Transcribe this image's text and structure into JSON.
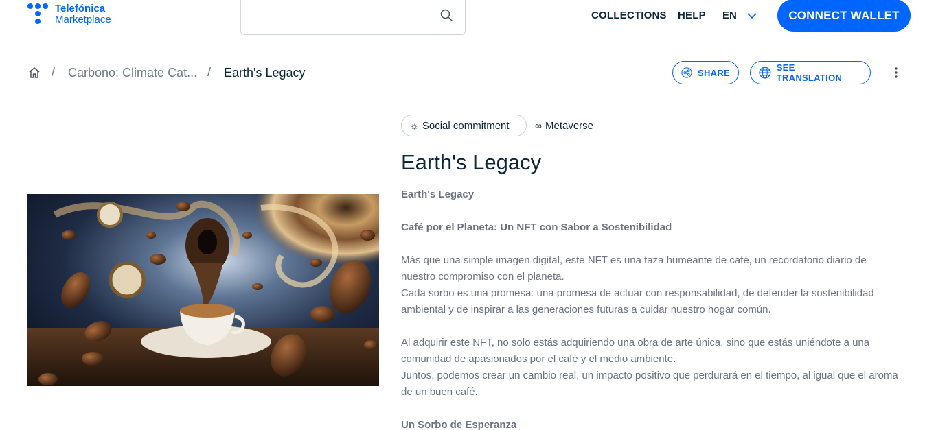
{
  "brand": {
    "line1": "Telefónica",
    "line2": "Marketplace"
  },
  "search": {
    "placeholder": ""
  },
  "nav": {
    "collections": "COLLECTIONS",
    "help": "HELP",
    "language": "EN",
    "connect_wallet": "CONNECT WALLET"
  },
  "breadcrumb": {
    "separator": "/",
    "collection": "Carbono: Climate Cat...",
    "current": "Earth's Legacy"
  },
  "actions": {
    "share": "SHARE",
    "see_translation": "SEE TRANSLATION"
  },
  "tags": [
    {
      "icon": "sun-icon",
      "label": "Social commitment"
    },
    {
      "icon": "infinity-icon",
      "label": "Metaverse"
    }
  ],
  "item": {
    "title": "Earth's Legacy",
    "description": {
      "heading1": "Earth's Legacy",
      "heading2": "Café por el Planeta: Un NFT con Sabor a Sostenibilidad",
      "p1a": "Más que una simple imagen digital, este NFT es una taza humeante de café, un recordatorio diario de nuestro compromiso con el planeta.",
      "p1b": "Cada sorbo es una promesa: una promesa de actuar con responsabilidad, de defender la sostenibilidad ambiental y de inspirar a las generaciones futuras a cuidar nuestro hogar común.",
      "p2a": "Al adquirir este NFT, no solo estás adquiriendo una obra de arte única, sino que estás uniéndote a una comunidad de apasionados por el café y el medio ambiente.",
      "p2b": "Juntos, podemos crear un cambio real, un impacto positivo que perdurará en el tiempo, al igual que el aroma de un buen café.",
      "heading3": "Un Sorbo de Esperanza"
    }
  },
  "colors": {
    "accent": "#0066ff",
    "text_dark": "#0b2739",
    "text_muted": "#6b7280"
  }
}
